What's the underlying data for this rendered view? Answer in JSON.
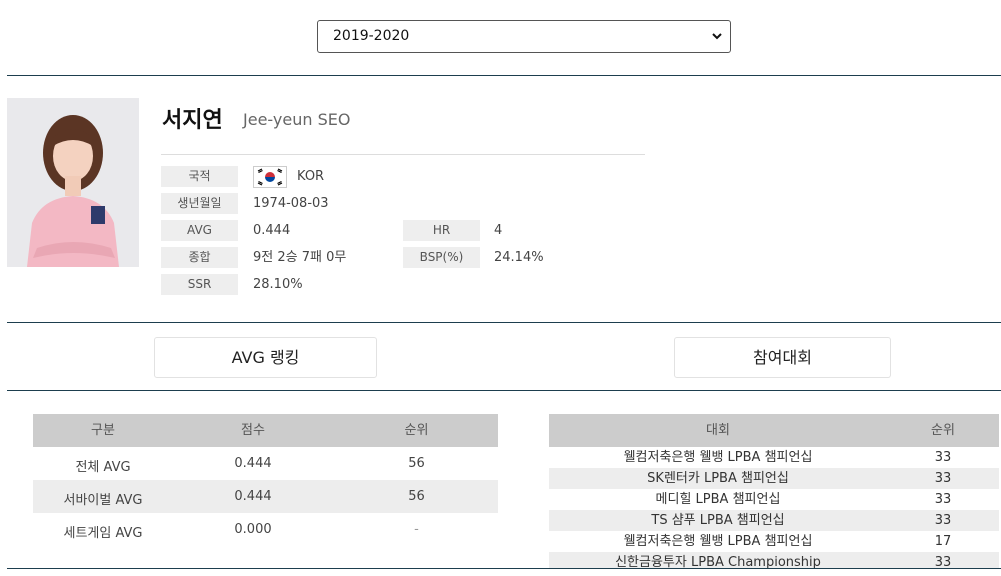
{
  "season": {
    "selected": "2019-2020"
  },
  "player": {
    "name_ko": "서지연",
    "name_en": "Jee-yeun SEO"
  },
  "info": {
    "nationality_label": "국적",
    "nationality": "KOR",
    "birth_label": "생년월일",
    "birth": "1974-08-03",
    "avg_label": "AVG",
    "avg": "0.444",
    "total_label": "종합",
    "total": "9전 2승 7패 0무",
    "ssr_label": "SSR",
    "ssr": "28.10%",
    "hr_label": "HR",
    "hr": "4",
    "bsp_label": "BSP(%)",
    "bsp": "24.14%"
  },
  "tabs": {
    "avg_ranking": "AVG 랭킹",
    "tournaments": "참여대회"
  },
  "avg_table": {
    "headers": [
      "구분",
      "점수",
      "순위"
    ],
    "rows": [
      [
        "전체 AVG",
        "0.444",
        "56"
      ],
      [
        "서바이벌 AVG",
        "0.444",
        "56"
      ],
      [
        "세트게임 AVG",
        "0.000",
        "-"
      ]
    ]
  },
  "tournament_table": {
    "headers": [
      "대회",
      "순위"
    ],
    "rows": [
      [
        "웰컴저축은행 웰뱅 LPBA 챔피언십",
        "33"
      ],
      [
        "SK렌터카 LPBA 챔피언십",
        "33"
      ],
      [
        "메디힐 LPBA 챔피언십",
        "33"
      ],
      [
        "TS 샴푸 LPBA 챔피언십",
        "33"
      ],
      [
        "웰컴저축은행 웰뱅 LPBA 챔피언십",
        "17"
      ],
      [
        "신한금융투자 LPBA Championship",
        "33"
      ]
    ]
  },
  "colors": {
    "divider": "#1d3e4e",
    "table_header": "#cccccc",
    "row_alt": "#ededed",
    "label_bg": "#eeeeee"
  }
}
